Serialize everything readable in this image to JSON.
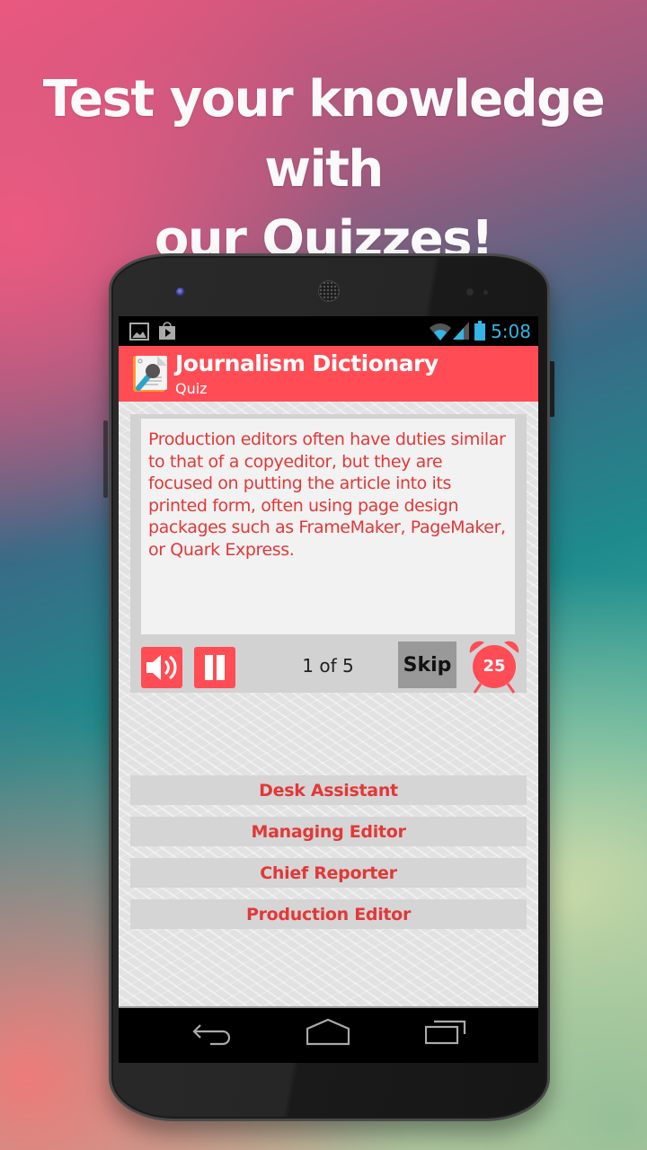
{
  "headline": {
    "line1": "Test your knowledge with",
    "line2": "our Quizzes!"
  },
  "status_bar": {
    "time": "5:08",
    "icons": [
      "gallery-icon",
      "play-store-icon",
      "wifi-icon",
      "signal-icon",
      "battery-icon"
    ]
  },
  "action_bar": {
    "title": "Journalism Dictionary",
    "subtitle": "Quiz",
    "icon": "microphone-document-icon"
  },
  "quiz": {
    "question": "Production editors often have duties similar to that of a copyeditor, but they are focused on putting the article into its printed form, often using page design packages such as FrameMaker, PageMaker, or Quark Express.",
    "progress": "1 of 5",
    "skip_label": "Skip",
    "timer_seconds": "25",
    "answers": [
      {
        "label": "Desk Assistant"
      },
      {
        "label": "Managing Editor"
      },
      {
        "label": "Chief Reporter"
      },
      {
        "label": "Production Editor"
      }
    ]
  },
  "nav_bar": {
    "items": [
      "back-icon",
      "home-icon",
      "recent-apps-icon"
    ]
  },
  "colors": {
    "accent": "#ff4c55",
    "answer_text": "#e23838",
    "status_time": "#33b5e5"
  }
}
